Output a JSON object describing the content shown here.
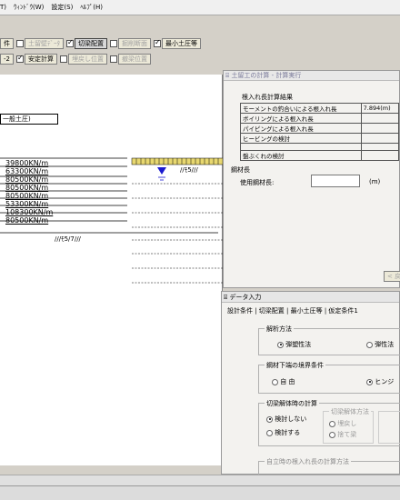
{
  "menu": [
    "T)",
    "ｳｨﾝﾄﾞｳ(W)",
    "設定(S)",
    "ﾍﾙﾌﾟ(H)"
  ],
  "toolbar": {
    "row1": [
      {
        "label": "件",
        "checked": null,
        "disabled": false
      },
      {
        "label": "土留壁ﾃﾞｰﾀ",
        "checked": false,
        "disabled": true
      },
      {
        "label": "切梁配置",
        "checked": true,
        "disabled": false
      },
      {
        "label": "掘削断面",
        "checked": false,
        "disabled": true
      },
      {
        "label": "最小土圧等",
        "checked": true,
        "disabled": false
      }
    ],
    "row2": [
      {
        "label": "-2",
        "checked": null,
        "disabled": false
      },
      {
        "label": "安定計算",
        "checked": true,
        "disabled": false
      },
      {
        "label": "埋戻し位置",
        "checked": false,
        "disabled": true
      },
      {
        "label": "撤梁位置",
        "checked": false,
        "disabled": true
      }
    ]
  },
  "canvas": {
    "box_label": "一般土圧)",
    "layers": [
      "39800KN/m",
      "63300KN/m",
      "80500KN/m",
      "80500KN/m",
      "80500KN/m",
      "53300KN/m",
      "108300KN/m",
      "80500KN/m"
    ],
    "ground_marks": [
      "//ﾓ5///",
      "///ﾓ5/7///"
    ]
  },
  "calc": {
    "title": "土留工の計算 - 計算実行",
    "section": "根入れ長計算結果",
    "rows": [
      {
        "label": "モーメントの釣合いによる根入れ長",
        "value": "7.894(m)"
      },
      {
        "label": "ボイリングによる根入れ長",
        "value": ""
      },
      {
        "label": "パイピングによる根入れ長",
        "value": ""
      },
      {
        "label": "ヒービングの検討",
        "value": ""
      },
      {
        "label": "",
        "value": ""
      },
      {
        "label": "盤ぶくれの検討",
        "value": ""
      }
    ],
    "steel_title": "鋼材長",
    "steel_label": "使用鋼材長:",
    "steel_unit": "(m)",
    "back_button": "< 戻"
  },
  "data": {
    "title": "データ入力",
    "tabs": "設計条件 | 切梁配置 | 最小土圧等 | 仮定条件1",
    "g1_title": "解析方法",
    "g1_opt1": "弾塑性法",
    "g1_opt2": "弾性法",
    "g2_title": "鋼材下端の境界条件",
    "g2_opt1": "自 由",
    "g2_opt2": "ヒンジ",
    "g3_title": "切梁解体時の計算",
    "g3_opt1": "検討しない",
    "g3_opt2": "検討する",
    "g3_sub_title": "切梁解体方法",
    "g3_sub1": "埋戻し",
    "g3_sub2": "捨て梁",
    "g4_title": "自立時の根入れ長の計算方法"
  },
  "colors": {
    "accent_blue": "#1a1ad0",
    "ground_yellow": "#e8d870",
    "layer_line": "#000000"
  }
}
